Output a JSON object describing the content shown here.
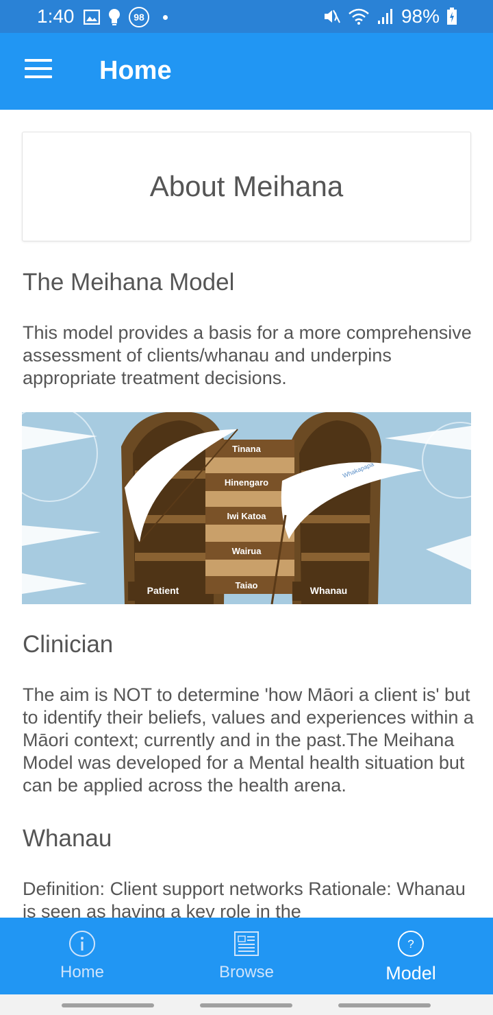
{
  "status_bar": {
    "time": "1:40",
    "badge": "98",
    "battery": "98%",
    "icons": [
      "image-icon",
      "bulb-icon",
      "badge-icon",
      "dot-icon",
      "mute-icon",
      "wifi-icon",
      "signal-icon",
      "battery-icon"
    ]
  },
  "app_bar": {
    "title": "Home",
    "menu_icon": "hamburger-icon"
  },
  "about_card": {
    "title": "About Meihana"
  },
  "sections": [
    {
      "heading": "The Meihana Model",
      "body": "This model provides a basis for a more comprehensive assessment of clients/whanau and underpins appropriate treatment decisions."
    },
    {
      "heading": "Clinician",
      "body": "The aim is NOT to determine 'how Māori a client is' but to identify their beliefs, values and experiences within a Māori context; currently and in the past.The Meihana Model was developed for a Mental health situation but can be applied across the health arena."
    },
    {
      "heading": "Whanau",
      "body": "Definition: Client support networks Rationale: Whanau is seen as having a key role in the"
    }
  ],
  "figure": {
    "planks": [
      "Tinana",
      "Hinengaro",
      "Iwi Katoa",
      "Wairua",
      "Taiao"
    ],
    "left_hull": "Patient",
    "right_hull": "Whanau",
    "sail_text": "Whakapapa"
  },
  "bottom_nav": {
    "items": [
      {
        "label": "Home",
        "icon": "info-icon",
        "active": false
      },
      {
        "label": "Browse",
        "icon": "book-icon",
        "active": false
      },
      {
        "label": "Model",
        "icon": "help-icon",
        "active": true
      }
    ]
  },
  "colors": {
    "primary": "#2196f3",
    "status": "#2a82d6",
    "sea": "#a7cbe0",
    "hull": "#6b4a23",
    "plank": "#c9a06a"
  }
}
